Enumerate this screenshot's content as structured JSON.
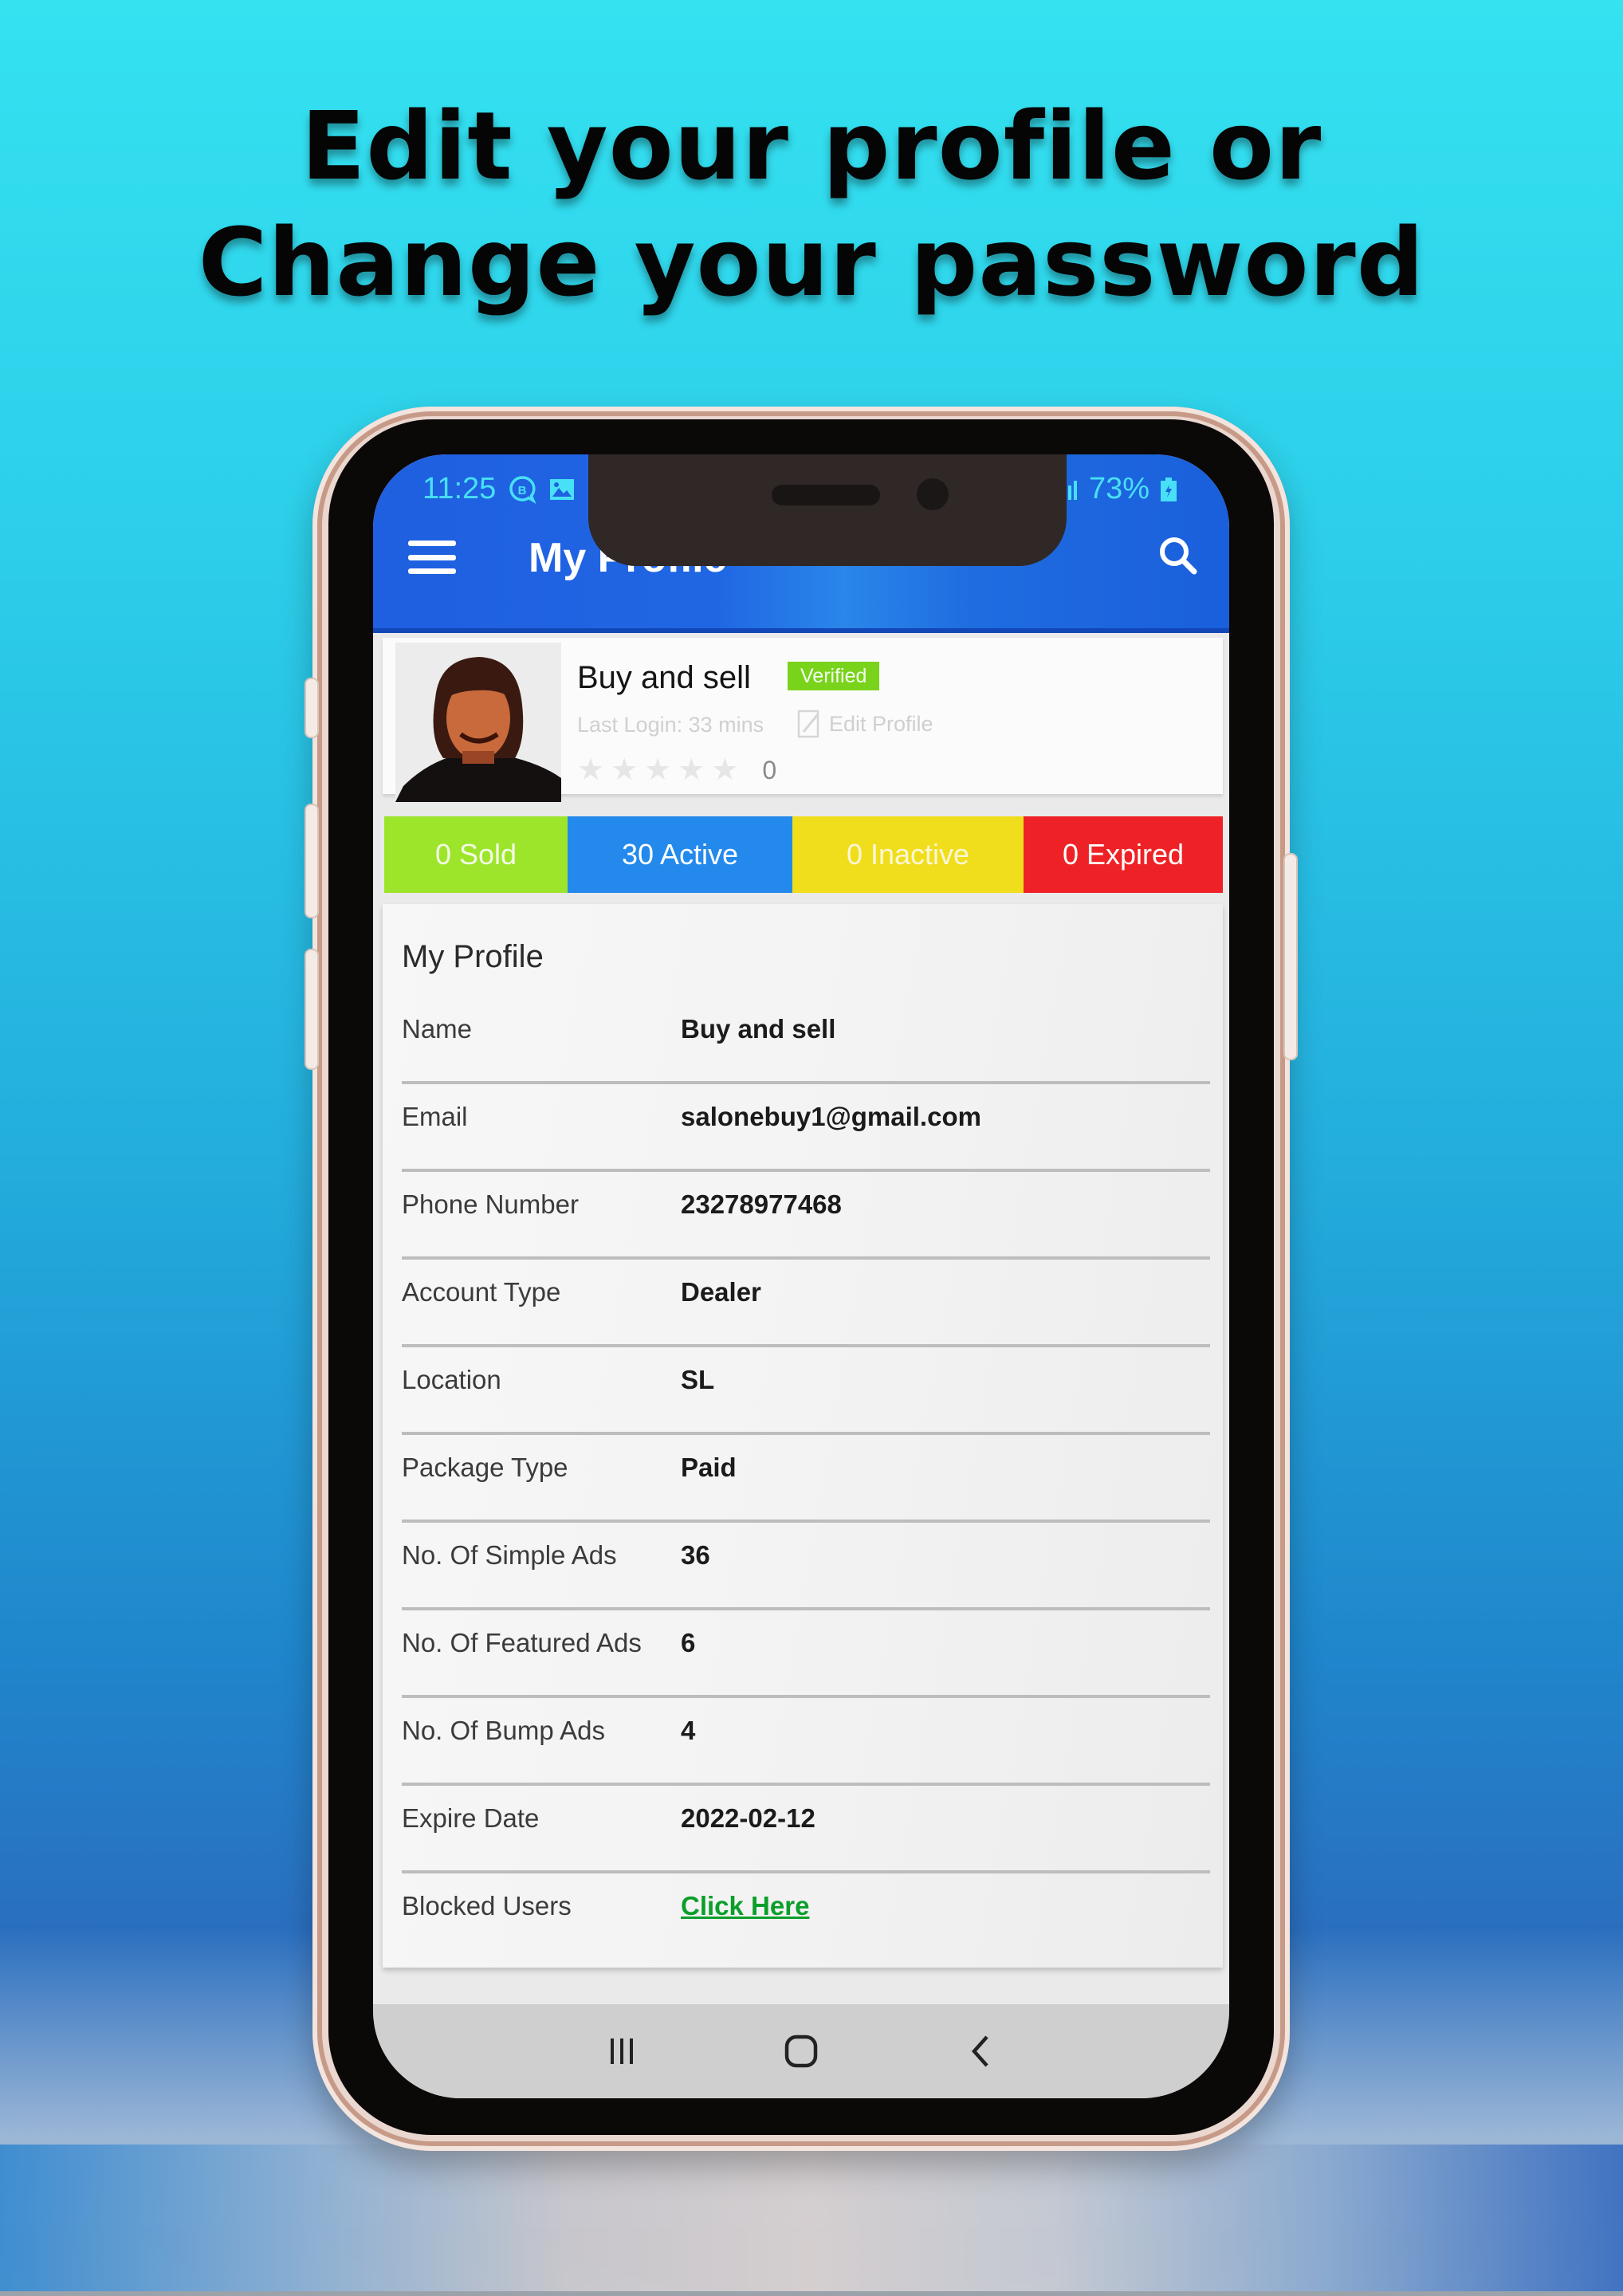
{
  "promo": {
    "headline_line1": "Edit your profile or",
    "headline_line2": "Change your password"
  },
  "status_bar": {
    "time": "11:25",
    "left_icons": [
      "bbm-icon",
      "gallery-icon"
    ],
    "right_icons": [
      "signal-icon",
      "signal-icon"
    ],
    "battery": "73%"
  },
  "app_bar": {
    "title": "My Profile",
    "menu_icon": "hamburger-menu-icon",
    "search_icon": "search-icon"
  },
  "user": {
    "name": "Buy and sell",
    "badge": "Verified",
    "last_login": "Last Login: 33 mins",
    "edit_profile_label": "Edit Profile",
    "rating": 0,
    "rating_max": 5,
    "rating_count": "0"
  },
  "stats": [
    {
      "label": "0 Sold",
      "color": "#9de52a"
    },
    {
      "label": "30 Active",
      "color": "#2389ec"
    },
    {
      "label": "0 Inactive",
      "color": "#f0de1c"
    },
    {
      "label": "0 Expired",
      "color": "#ee2226"
    }
  ],
  "profile": {
    "section_title": "My Profile",
    "rows": [
      {
        "label": "Name",
        "value": "Buy and sell"
      },
      {
        "label": "Email",
        "value": "salonebuy1@gmail.com"
      },
      {
        "label": "Phone Number",
        "value": "23278977468"
      },
      {
        "label": "Account Type",
        "value": "Dealer"
      },
      {
        "label": "Location",
        "value": "SL"
      },
      {
        "label": "Package Type",
        "value": "Paid"
      },
      {
        "label": "No. Of Simple Ads",
        "value": "36"
      },
      {
        "label": "No. Of Featured Ads",
        "value": "6"
      },
      {
        "label": "No. Of Bump Ads",
        "value": "4"
      },
      {
        "label": "Expire Date",
        "value": "2022-02-12"
      },
      {
        "label": "Blocked Users",
        "value": "Click Here"
      }
    ]
  },
  "nav_bar": {
    "buttons": [
      "recent-apps-icon",
      "home-icon",
      "back-icon"
    ]
  },
  "colors": {
    "app_bar": "#1f62e0",
    "verified": "#79d31b",
    "link": "#0c9e2a"
  }
}
